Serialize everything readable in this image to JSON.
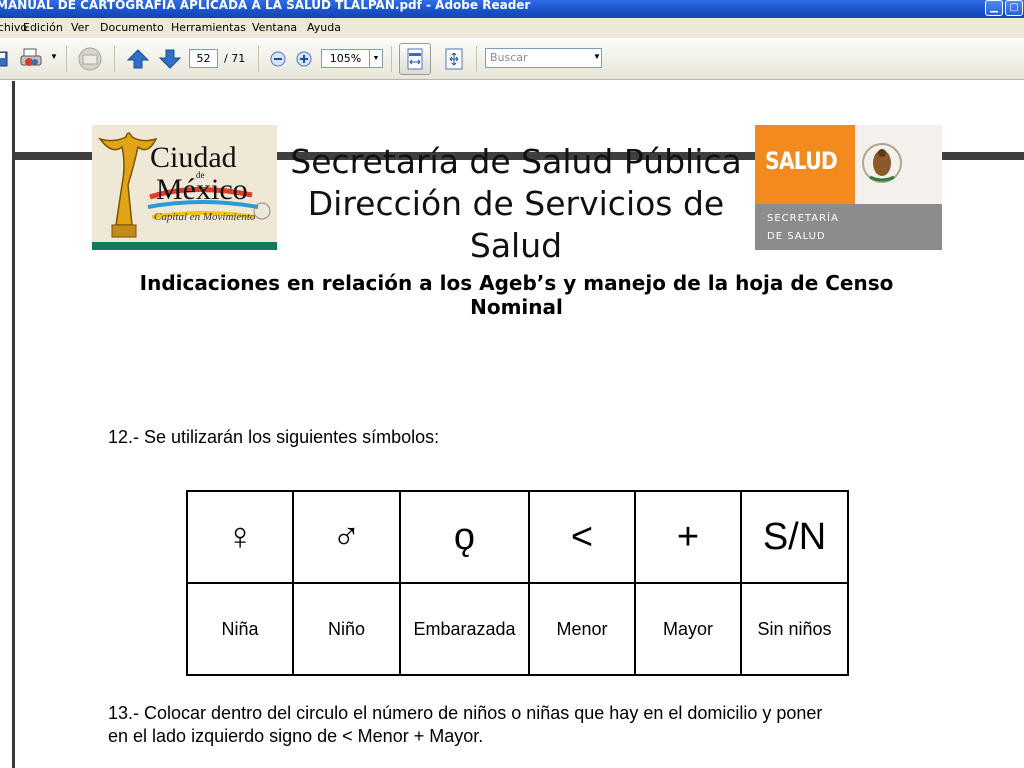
{
  "window": {
    "title": "MANUAL DE CARTOGRAFIA APLICADA A LA SALUD TLALPAN.pdf - Adobe Reader",
    "minimize_icon": "minimize-icon",
    "maximize_icon": "maximize-icon"
  },
  "menu": [
    "Archivo",
    "Edición",
    "Ver",
    "Documento",
    "Herramientas",
    "Ventana",
    "Ayuda"
  ],
  "toolbar": {
    "current_page": "52",
    "page_separator": "/ 71",
    "zoom": "105%",
    "search_placeholder": "Buscar",
    "colors": {
      "arrow": "#2f6fc7",
      "accent": "#1a51c9"
    }
  },
  "document": {
    "header_title_line1": "Secretaría de Salud Pública",
    "header_title_line2": "Dirección de Servicios de Salud",
    "logo_left": {
      "line1": "Ciudad",
      "line2": "de",
      "line3": "México",
      "tagline": "Capital en Movimiento"
    },
    "logo_right": {
      "brand": "SALUD",
      "sub1": "SECRETARÍA",
      "sub2": "DE SALUD",
      "brand_color": "#f28a1e"
    },
    "heading": "Indicaciones en relación a los Ageb’s y manejo de la hoja de Censo Nominal",
    "item12": "12.- Se utilizarán los siguientes símbolos:",
    "symbols": [
      {
        "symbol": "♀",
        "label": "Niña"
      },
      {
        "symbol": "♂",
        "label": "Niño"
      },
      {
        "symbol": "ǫ",
        "label": "Embarazada"
      },
      {
        "symbol": "<",
        "label": "Menor"
      },
      {
        "symbol": "+",
        "label": "Mayor"
      },
      {
        "symbol": "S/N",
        "label": "Sin niños"
      }
    ],
    "item13_line1": "13.- Colocar dentro del circulo el número de niños o niñas que hay en el domicilio y poner",
    "item13_line2": "en el lado izquierdo signo de < Menor + Mayor."
  }
}
